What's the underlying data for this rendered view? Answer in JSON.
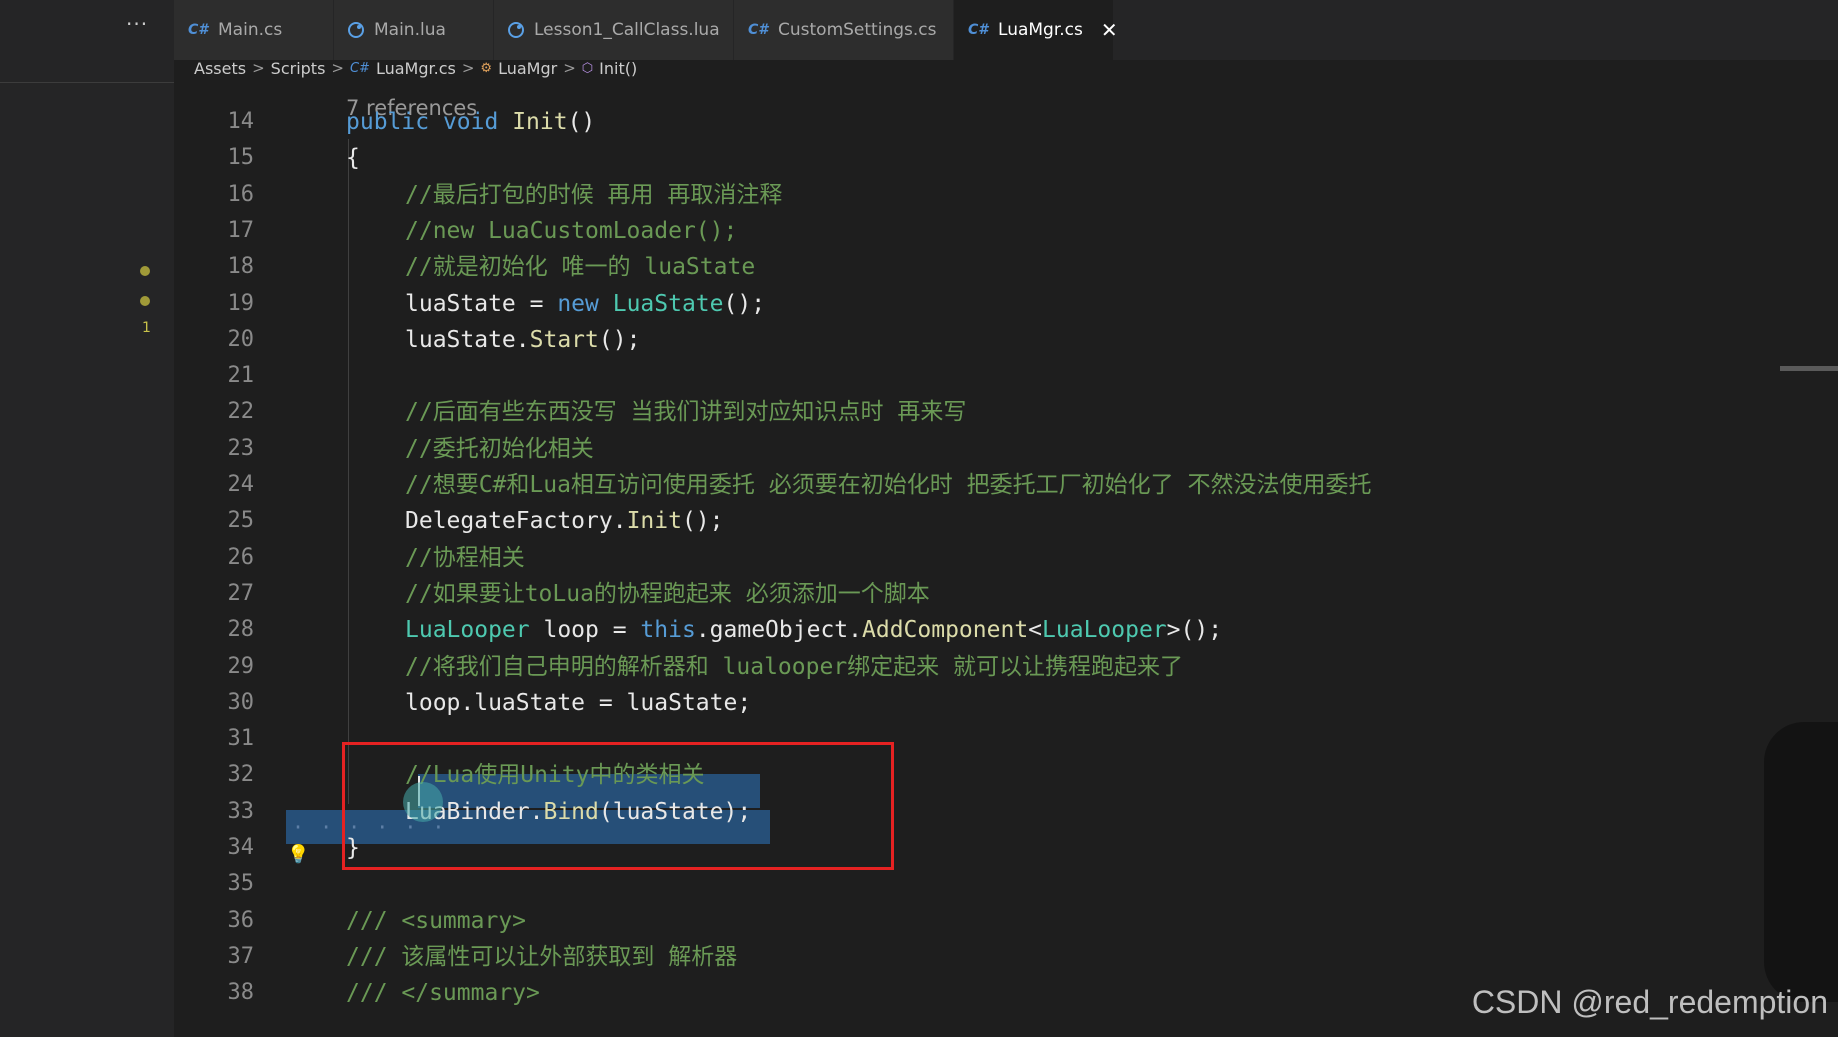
{
  "sidebar": {
    "more_label": "···",
    "gutter_badge": "1"
  },
  "tabs": [
    {
      "icon": "C#",
      "label": "Main.cs",
      "active": false
    },
    {
      "icon": "lua",
      "label": "Main.lua",
      "active": false
    },
    {
      "icon": "lua",
      "label": "Lesson1_CallClass.lua",
      "active": false
    },
    {
      "icon": "C#",
      "label": "CustomSettings.cs",
      "active": false
    },
    {
      "icon": "C#",
      "label": "LuaMgr.cs",
      "active": true,
      "close": "✕"
    }
  ],
  "breadcrumb": {
    "items": [
      "Assets",
      "Scripts",
      "LuaMgr.cs",
      "LuaMgr",
      "Init()"
    ],
    "separator": ">",
    "cs_icon": "C#"
  },
  "editor": {
    "codelens": "7 references",
    "lines": [
      {
        "n": "14",
        "tokens": [
          [
            "kw",
            "public "
          ],
          [
            "kw",
            "void "
          ],
          [
            "fn",
            "Init"
          ],
          [
            "pl",
            "()"
          ]
        ]
      },
      {
        "n": "15",
        "tokens": [
          [
            "pl",
            "{"
          ]
        ]
      },
      {
        "n": "16",
        "tokens": [
          [
            "cm",
            "//最后打包的时候 再用 再取消注释"
          ]
        ]
      },
      {
        "n": "17",
        "tokens": [
          [
            "cm",
            "//new LuaCustomLoader();"
          ]
        ]
      },
      {
        "n": "18",
        "tokens": [
          [
            "cm",
            "//就是初始化 唯一的 luaState"
          ]
        ]
      },
      {
        "n": "19",
        "tokens": [
          [
            "pl",
            "luaState = "
          ],
          [
            "kw",
            "new "
          ],
          [
            "ty",
            "LuaState"
          ],
          [
            "pl",
            "();"
          ]
        ]
      },
      {
        "n": "20",
        "tokens": [
          [
            "pl",
            "luaState."
          ],
          [
            "fn",
            "Start"
          ],
          [
            "pl",
            "();"
          ]
        ]
      },
      {
        "n": "21",
        "tokens": []
      },
      {
        "n": "22",
        "tokens": [
          [
            "cm",
            "//后面有些东西没写 当我们讲到对应知识点时 再来写"
          ]
        ]
      },
      {
        "n": "23",
        "tokens": [
          [
            "cm",
            "//委托初始化相关"
          ]
        ]
      },
      {
        "n": "24",
        "tokens": [
          [
            "cm",
            "//想要C#和Lua相互访问使用委托 必须要在初始化时 把委托工厂初始化了 不然没法使用委托"
          ]
        ]
      },
      {
        "n": "25",
        "tokens": [
          [
            "pl",
            "DelegateFactory."
          ],
          [
            "fn",
            "Init"
          ],
          [
            "pl",
            "();"
          ]
        ]
      },
      {
        "n": "26",
        "tokens": [
          [
            "cm",
            "//协程相关"
          ]
        ]
      },
      {
        "n": "27",
        "tokens": [
          [
            "cm",
            "//如果要让toLua的协程跑起来 必须添加一个脚本"
          ]
        ]
      },
      {
        "n": "28",
        "tokens": [
          [
            "ty",
            "LuaLooper "
          ],
          [
            "pl",
            "loop = "
          ],
          [
            "kw",
            "this"
          ],
          [
            "pl",
            "."
          ],
          [
            "pl",
            "gameObject."
          ],
          [
            "fn",
            "AddComponent"
          ],
          [
            "pl",
            "<"
          ],
          [
            "ty",
            "LuaLooper"
          ],
          [
            "pl",
            ">();"
          ]
        ]
      },
      {
        "n": "29",
        "tokens": [
          [
            "cm",
            "//将我们自己申明的解析器和 lualooper绑定起来 就可以让携程跑起来了"
          ]
        ]
      },
      {
        "n": "30",
        "tokens": [
          [
            "pl",
            "loop.luaState = luaState;"
          ]
        ]
      },
      {
        "n": "31",
        "tokens": []
      },
      {
        "n": "32",
        "tokens": [
          [
            "cm",
            "//Lua使用Unity中的类相关"
          ]
        ]
      },
      {
        "n": "33",
        "tokens": [
          [
            "pl",
            "LuaBinder."
          ],
          [
            "fn",
            "Bind"
          ],
          [
            "pl",
            "(luaState);"
          ]
        ]
      },
      {
        "n": "34",
        "tokens": [
          [
            "pl",
            "}"
          ]
        ]
      },
      {
        "n": "35",
        "tokens": []
      },
      {
        "n": "36",
        "tokens": [
          [
            "cm",
            "/// <summary>"
          ]
        ]
      },
      {
        "n": "37",
        "tokens": [
          [
            "cm",
            "/// 该属性可以让外部获取到 解析器"
          ]
        ]
      },
      {
        "n": "38",
        "tokens": [
          [
            "cm",
            "/// </summary>"
          ]
        ]
      }
    ]
  },
  "colors": {
    "keyword": "#569cd6",
    "type": "#4ec9b0",
    "comment": "#6a9955",
    "function": "#dcdcaa",
    "highlight_box": "#e52222",
    "selection": "#264f78"
  },
  "watermark": "CSDN @red_redemption"
}
